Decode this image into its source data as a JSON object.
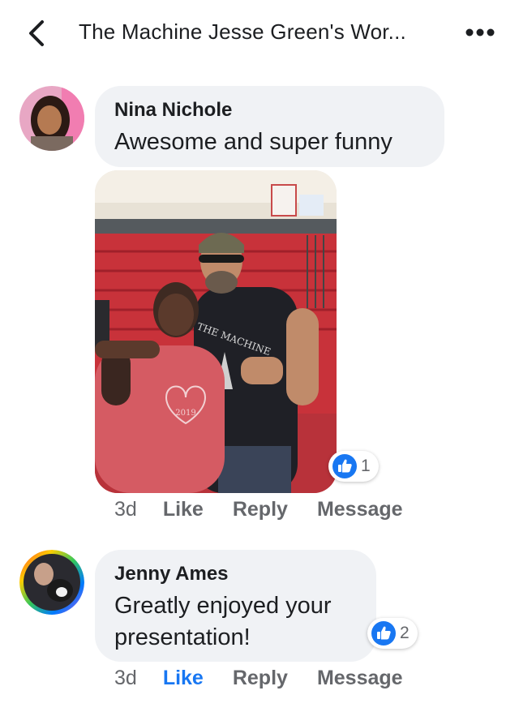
{
  "header": {
    "title": "The Machine Jesse Green's Wor...",
    "back_icon": "chevron-left-icon",
    "more_icon": "more-dots-icon"
  },
  "comments": [
    {
      "author": "Nina Nichole",
      "text": "Awesome and super funny",
      "has_photo": true,
      "reaction_icon": "like-icon",
      "reaction_count": "1",
      "time": "3d",
      "actions": {
        "like": "Like",
        "reply": "Reply",
        "message": "Message"
      },
      "liked": false
    },
    {
      "author": "Jenny Ames",
      "text_line1": "Greatly enjoyed your",
      "text_line2": "presentation!",
      "reaction_icon": "like-icon",
      "reaction_count": "2",
      "time": "3d",
      "actions": {
        "like": "Like",
        "reply": "Reply",
        "message": "Message"
      },
      "liked": true
    }
  ],
  "photo": {
    "shirt_text_1": "THE MACHINE",
    "shirt_text_2": "2019"
  },
  "colors": {
    "bubble_bg": "#f0f2f5",
    "like_blue": "#1877f2",
    "secondary_text": "#65676b"
  }
}
